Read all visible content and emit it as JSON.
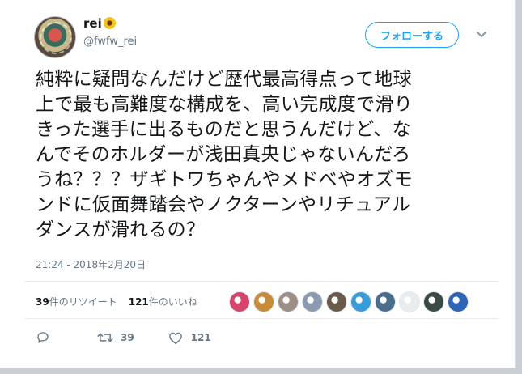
{
  "user": {
    "display_name": "rei",
    "handle": "@fwfw_rei",
    "avatar_icon": "avatar-image",
    "name_emoji_icon": "sunflower-icon"
  },
  "follow_button": {
    "label": "フォローする"
  },
  "tweet": {
    "lines": [
      "純粋に疑問なんだけど歴代最高得点って地球",
      "上で最も高難度な構成を、高い完成度で滑り",
      "きった選手に出るものだと思うんだけど、な",
      "んでそのホルダーが浅田真央じゃないんだろ",
      "うね？？？ザギトワちゃんやメドべやオズモ",
      "ンドに仮面舞踏会やノクターンやリチュアル",
      "ダンスが滑れるの？"
    ],
    "timestamp": "21:24 - 2018年2月20日"
  },
  "stats": {
    "retweet_count": "39",
    "retweet_label": "件のリツイート",
    "like_count": "121",
    "like_label": "件のいいね"
  },
  "liker_avatars": [
    {
      "color": "#d9436b"
    },
    {
      "color": "#c98a3a"
    },
    {
      "color": "#9d8f86"
    },
    {
      "color": "#8a9bb0"
    },
    {
      "color": "#6b5b4a"
    },
    {
      "color": "#3a9bd9"
    },
    {
      "color": "#4a6d8c"
    },
    {
      "color": "#e8ecef"
    },
    {
      "color": "#3b4a44"
    },
    {
      "color": "#2f63b5"
    }
  ],
  "actions": {
    "reply_icon": "reply-icon",
    "retweet_icon": "retweet-icon",
    "retweet_count": "39",
    "like_icon": "heart-icon",
    "like_count": "121"
  },
  "colors": {
    "accent": "#1da1f2",
    "text": "#14171a",
    "muted": "#657786"
  }
}
